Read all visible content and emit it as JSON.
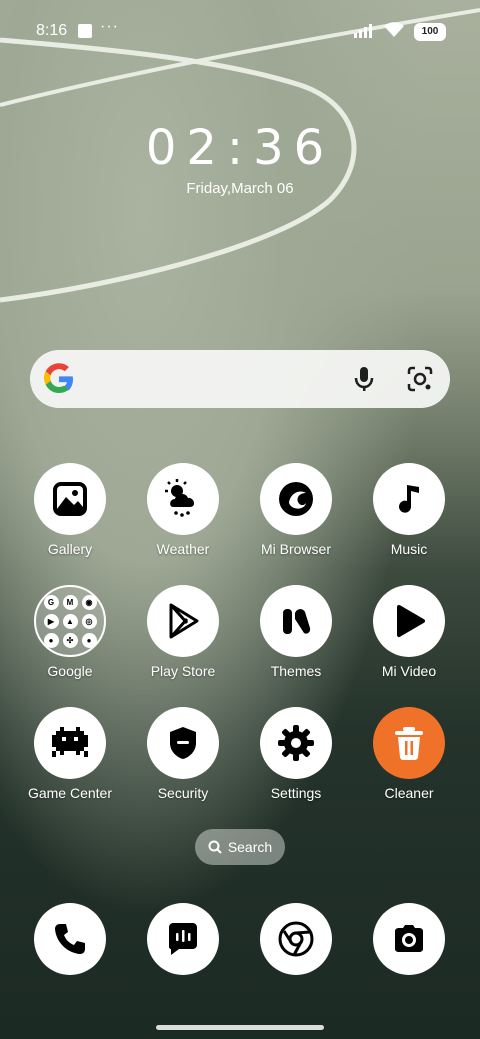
{
  "status_bar": {
    "time": "8:16",
    "more_indicator": "···",
    "battery": "100"
  },
  "clock": {
    "time": "02:36",
    "date": "Friday,March 06"
  },
  "search_widget": {
    "logo": "google-g-icon",
    "mic_icon": "mic-icon",
    "lens_icon": "google-lens-icon"
  },
  "apps": [
    {
      "label": "Gallery",
      "icon": "gallery-icon"
    },
    {
      "label": "Weather",
      "icon": "weather-icon"
    },
    {
      "label": "Mi Browser",
      "icon": "mi-browser-icon"
    },
    {
      "label": "Music",
      "icon": "music-icon"
    },
    {
      "label": "Google",
      "icon": "google-folder-icon"
    },
    {
      "label": "Play Store",
      "icon": "play-store-icon"
    },
    {
      "label": "Themes",
      "icon": "themes-icon"
    },
    {
      "label": "Mi Video",
      "icon": "mi-video-icon"
    },
    {
      "label": "Game Center",
      "icon": "game-center-icon"
    },
    {
      "label": "Security",
      "icon": "security-icon"
    },
    {
      "label": "Settings",
      "icon": "settings-icon"
    },
    {
      "label": "Cleaner",
      "icon": "cleaner-icon"
    }
  ],
  "folder_contents": [
    "G",
    "M",
    "◉",
    "▶",
    "▲",
    "◎",
    "●",
    "✣",
    "●"
  ],
  "app_drawer_search": {
    "label": "Search"
  },
  "dock": [
    {
      "icon": "phone-icon"
    },
    {
      "icon": "messages-icon"
    },
    {
      "icon": "chrome-icon"
    },
    {
      "icon": "camera-icon"
    }
  ],
  "colors": {
    "cleaner_accent": "#f07228"
  }
}
